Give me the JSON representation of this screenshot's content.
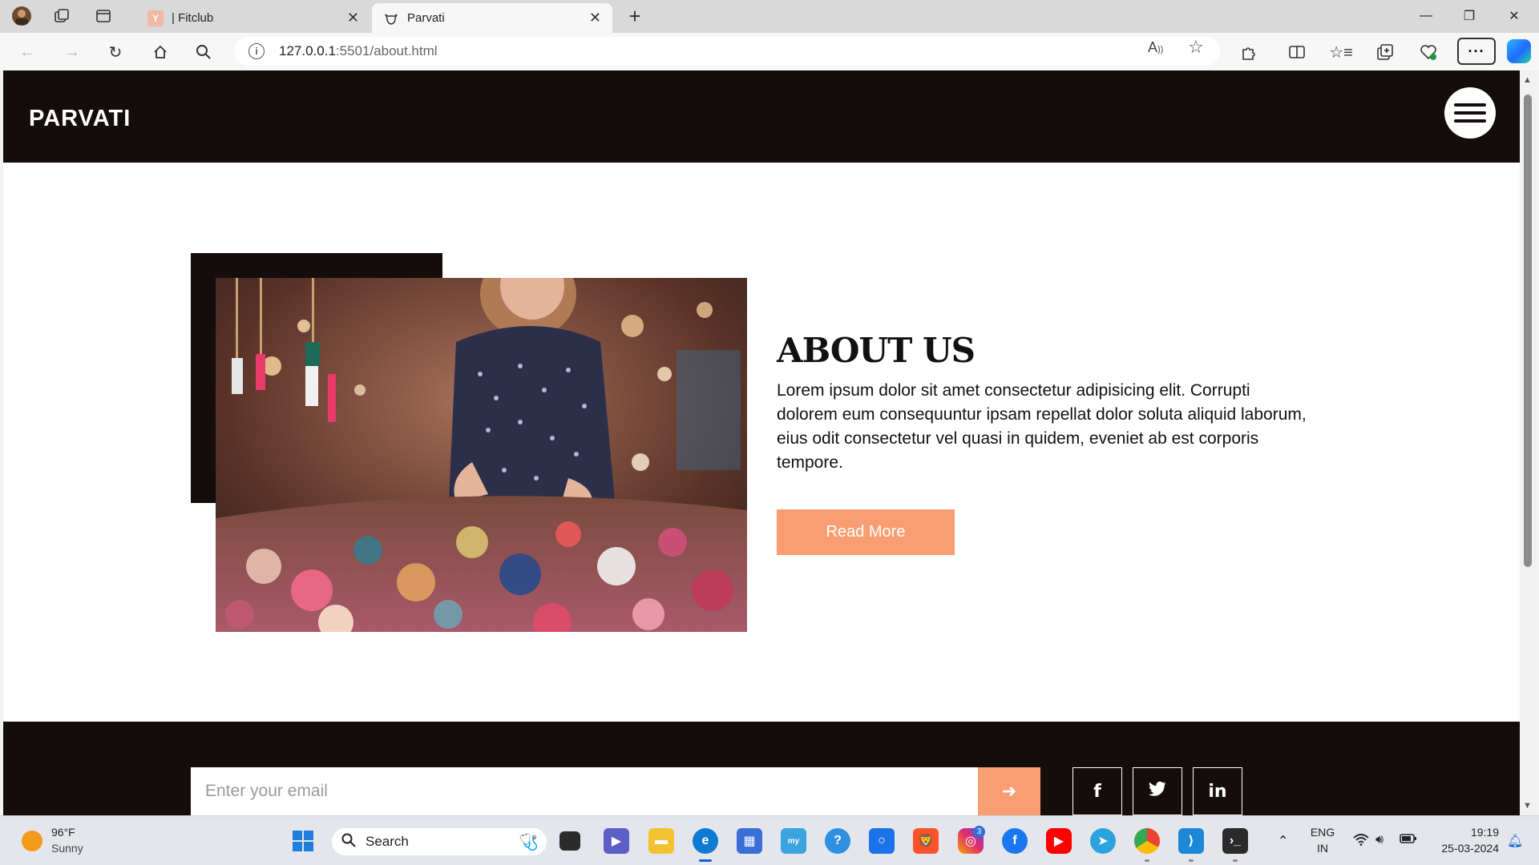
{
  "browser": {
    "tabs": [
      {
        "title": "| Fitclub",
        "favicon": "y-logo-icon"
      },
      {
        "title": "Parvati",
        "favicon": "bull-logo-icon"
      }
    ],
    "address": {
      "host": "127.0.0.1",
      "path": ":5501/about.html"
    }
  },
  "site": {
    "brand": "PARVATI",
    "about": {
      "title": "ABOUT US",
      "text": "Lorem ipsum dolor sit amet consectetur adipisicing elit. Corrupti dolorem eum consequuntur ipsam repellat dolor soluta aliquid laborum, eius odit consectetur vel quasi in quidem, eveniet ab est corporis tempore.",
      "button": "Read More"
    },
    "footer": {
      "email_placeholder": "Enter your email",
      "socials": [
        "f",
        "t",
        "in"
      ]
    },
    "colors": {
      "dark": "#140d0b",
      "accent": "#f99e73"
    }
  },
  "taskbar": {
    "weather": {
      "temp": "96°F",
      "condition": "Sunny"
    },
    "search_label": "Search",
    "language": {
      "lang": "ENG",
      "region": "IN"
    },
    "clock": {
      "time": "19:19",
      "date": "25-03-2024"
    },
    "badges": {
      "instagram": "3"
    }
  }
}
